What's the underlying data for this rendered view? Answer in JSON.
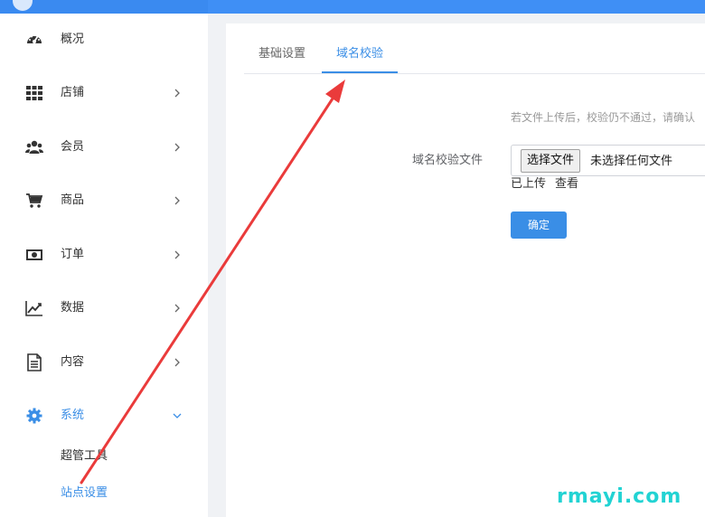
{
  "colors": {
    "accent": "#3a8ee6",
    "topbar": "#3f8ff5",
    "annotation_arrow": "#ea3b3b",
    "watermark": "#22d3d3"
  },
  "sidebar": {
    "items": [
      {
        "label": "概况",
        "icon": "dashboard-gauge-icon",
        "has_arrow": false
      },
      {
        "label": "店铺",
        "icon": "grid-icon",
        "has_arrow": true
      },
      {
        "label": "会员",
        "icon": "users-icon",
        "has_arrow": true
      },
      {
        "label": "商品",
        "icon": "cart-icon",
        "has_arrow": true
      },
      {
        "label": "订单",
        "icon": "money-icon",
        "has_arrow": true
      },
      {
        "label": "数据",
        "icon": "line-chart-icon",
        "has_arrow": true
      },
      {
        "label": "内容",
        "icon": "document-icon",
        "has_arrow": true
      },
      {
        "label": "系统",
        "icon": "gear-icon",
        "has_arrow": true,
        "expanded": true
      }
    ],
    "sub_items": [
      {
        "label": "超管工具"
      },
      {
        "label": "站点设置",
        "active": true
      }
    ]
  },
  "tabs": [
    {
      "label": "基础设置"
    },
    {
      "label": "域名校验",
      "active": true
    }
  ],
  "form": {
    "hint": "若文件上传后，校验仍不通过，请确认",
    "label": "域名校验文件",
    "file_button": "选择文件",
    "file_status": "未选择任何文件",
    "uploaded_text": "已上传",
    "view_link": "查看",
    "confirm": "确定"
  },
  "watermark": "rmayi.com"
}
